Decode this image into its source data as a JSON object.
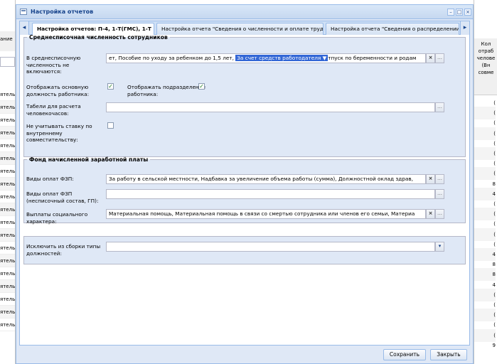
{
  "background": {
    "left_header": "ание",
    "left_rows": [
      "ятель",
      "ятель",
      "ятель",
      "ятель",
      "ятель",
      "ятель",
      "ятель",
      "ятель",
      "ятель",
      "ятель",
      "ятель",
      "ятель",
      "ятель",
      "ятель",
      "ятель",
      "ятель",
      "ятель",
      "ятель",
      "ятель"
    ],
    "right_header": "Кол отраб челове (Вн совме",
    "right_rows": [
      "(",
      "(",
      "(",
      "(",
      "(",
      "(",
      "(",
      "(",
      "8",
      "4",
      "(",
      "(",
      "(",
      "(",
      "(",
      "4",
      "8",
      "8",
      "4",
      "(",
      "(",
      "(",
      "(",
      "(",
      "9"
    ]
  },
  "window": {
    "title": "Настройка отчетов",
    "tools": {
      "min": "–",
      "max": "□",
      "close": "×"
    }
  },
  "tabs": [
    {
      "label": "Настройка отчетов: П-4, 1-Т(ГМС), 1-Т"
    },
    {
      "label": "Настройка отчета \"Сведения о численности и оплате труда\""
    },
    {
      "label": "Настройка отчета \"Сведения о распределении чи"
    }
  ],
  "tab_scroll": {
    "left": "◂",
    "right": "▸"
  },
  "section_avg": {
    "legend": "Среднесписочная численность сотрудников",
    "excluded_label": "В среднесписочную численность не включаются:",
    "excluded_value_pre": "ет, Пособие по уходу за ребенком до 1,5 лет, ",
    "excluded_value_selected": "За счет средств работодателя ▼",
    "excluded_value_post": "тпуск по беременности и родам",
    "show_main_position_label": "Отображать основную должность работника:",
    "show_main_position_checked": "✓",
    "show_subdivision_label": "Отображать подразделение работника:",
    "show_subdivision_checked": "✓",
    "timesheets_label": "Табели для расчета человекочасов:",
    "timesheets_value": "",
    "ignore_rate_label": "Не учитывать ставку по внутреннему совместительству:",
    "ignore_rate_checked": ""
  },
  "section_fund": {
    "legend": "Фонд начисленной заработной платы",
    "fzp_label": "Виды оплат ФЗП:",
    "fzp_value": "За работу в сельской местности, Надбавка за увеличение объема работы (сумма), Должностной оклад здрав,",
    "fzp_noncount_label": "Виды оплат ФЗП (несписочный состав, ГП):",
    "fzp_noncount_value": "",
    "social_label": "Выплаты социального характера:",
    "social_value": "Материальная помощь, Материальная помощь в связи со смертью сотрудника или членов его семьи, Материа"
  },
  "section_exclude": {
    "label": "Исключить из сборки типы должностей:",
    "value": ""
  },
  "trigger_glyphs": {
    "clear": "×",
    "more": "…",
    "down": "▾"
  },
  "buttons": {
    "save": "Сохранить",
    "close": "Закрыть"
  }
}
